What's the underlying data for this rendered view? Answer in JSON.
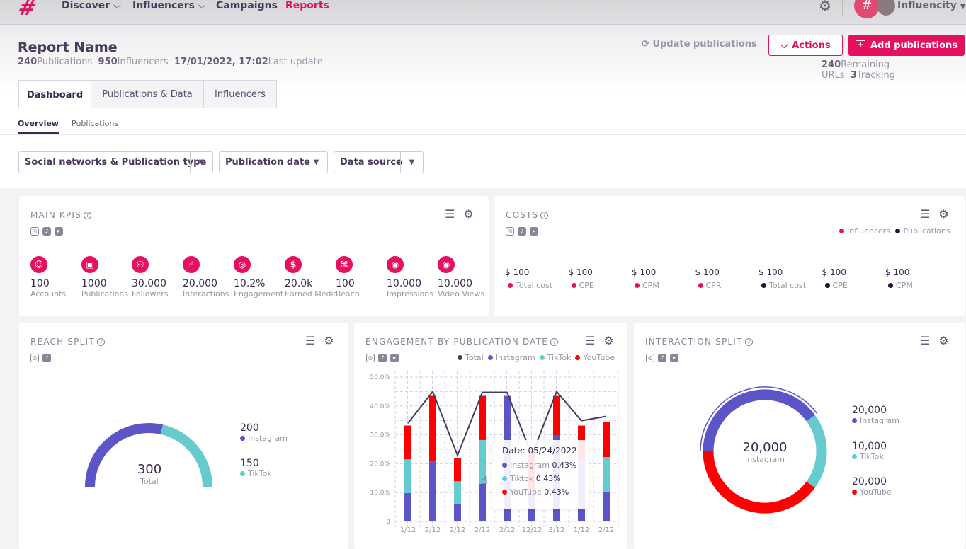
{
  "nav": {
    "logo": "#",
    "items": [
      {
        "label": "Discover",
        "dropdown": true
      },
      {
        "label": "Influencers",
        "dropdown": true
      },
      {
        "label": "Campaigns"
      },
      {
        "label": "Reports",
        "active": true
      }
    ],
    "account": "Influencity"
  },
  "report": {
    "title": "Report Name",
    "publications_count": "240",
    "publications_label": "Publications",
    "influencers_count": "950",
    "influencers_label": "Influencers",
    "last_update": "17/01/2022, 17:02",
    "last_update_label": "Last update"
  },
  "actions": {
    "update": "Update publications",
    "actions": "Actions",
    "add": "Add publications",
    "remaining_count": "240",
    "remaining_label": "Remaining URLs",
    "tracking_count": "3",
    "tracking_label": "Tracking"
  },
  "tabs": [
    {
      "label": "Dashboard",
      "active": true
    },
    {
      "label": "Publications & Data"
    },
    {
      "label": "Influencers"
    }
  ],
  "subtabs": [
    {
      "label": "Overview",
      "active": true
    },
    {
      "label": "Publications"
    }
  ],
  "filters": [
    "Social networks & Publication type",
    "Publication date",
    "Data source"
  ],
  "colors": {
    "brand": "#e5105f",
    "instagram": "#5b55c8",
    "tiktok": "#66cbcf",
    "youtube": "#ff0000",
    "total": "#4a3a5e",
    "publications": "#2a1236"
  },
  "main_kpis": {
    "title": "MAIN KPIS",
    "items": [
      {
        "icon": "user-icon",
        "value": "100",
        "label": "Accounts"
      },
      {
        "icon": "publication-icon",
        "value": "1000",
        "label": "Publications"
      },
      {
        "icon": "followers-icon",
        "value": "30.000",
        "label": "Followers"
      },
      {
        "icon": "hand-pointer-icon",
        "value": "20.000",
        "label": "Interactions"
      },
      {
        "icon": "target-icon",
        "value": "10.2%",
        "label": "Engagement"
      },
      {
        "icon": "dollar-icon",
        "value": "20.0k",
        "label": "Earned Media"
      },
      {
        "icon": "reach-icon",
        "value": "100",
        "label": "Reach"
      },
      {
        "icon": "eye-icon",
        "value": "10.000",
        "label": "Impressions"
      },
      {
        "icon": "eye-icon",
        "value": "10.000",
        "label": "Video Views"
      }
    ]
  },
  "costs": {
    "title": "COSTS",
    "legend": [
      "Influencers",
      "Publications"
    ],
    "items": [
      {
        "value": "$ 100",
        "label": "Total cost",
        "group": "Influencers"
      },
      {
        "value": "$ 100",
        "label": "CPE",
        "group": "Influencers"
      },
      {
        "value": "$ 100",
        "label": "CPM",
        "group": "Influencers"
      },
      {
        "value": "$ 100",
        "label": "CPR",
        "group": "Influencers"
      },
      {
        "value": "$ 100",
        "label": "Total cost",
        "group": "Publications"
      },
      {
        "value": "$ 100",
        "label": "CPE",
        "group": "Publications"
      },
      {
        "value": "$ 100",
        "label": "CPM",
        "group": "Publications"
      }
    ]
  },
  "reach_split": {
    "title": "REACH SPLIT",
    "total": "300",
    "total_label": "Total",
    "items": [
      {
        "value": "200",
        "label": "Instagram",
        "num": 200
      },
      {
        "value": "150",
        "label": "TikTok",
        "num": 150
      }
    ]
  },
  "interaction_split": {
    "title": "INTERACTION SPLIT",
    "center_value": "20,000",
    "center_label": "Instagram",
    "items": [
      {
        "value": "20,000",
        "label": "Instagram",
        "num": 20000
      },
      {
        "value": "10,000",
        "label": "TikTok",
        "num": 10000
      },
      {
        "value": "20,000",
        "label": "YouTube",
        "num": 20000
      }
    ]
  },
  "engagement": {
    "title": "ENGAGEMENT BY PUBLICATION DATE",
    "tooltip": {
      "date": "Date: 05/24/2022",
      "rows": [
        {
          "label": "Instagram",
          "value": "0.43%"
        },
        {
          "label": "Tiktok",
          "value": "0.43%"
        },
        {
          "label": "YouTube",
          "value": "0.43%"
        }
      ]
    }
  },
  "chart_data": {
    "type": "bar",
    "stacked": true,
    "title": "ENGAGEMENT BY PUBLICATION DATE",
    "legend": "top-right",
    "grid": true,
    "categories": [
      "1/12",
      "2/12",
      "2/12",
      "2/12",
      "2/12",
      "12/12",
      "3/12",
      "1/12",
      "2/12"
    ],
    "ylim": [
      0,
      50
    ],
    "yticks": [
      "0",
      "10.0%",
      "20.0%",
      "30.0%",
      "40.0%",
      "50.0%"
    ],
    "series": [
      {
        "name": "Instagram",
        "type": "bar",
        "values": [
          9.8,
          20.8,
          6.1,
          13,
          43.5,
          10,
          29.8,
          21.5,
          10.2
        ]
      },
      {
        "name": "TikTok",
        "type": "bar",
        "values": [
          11.7,
          0,
          7.8,
          15.2,
          0,
          0,
          0,
          0,
          12.1
        ]
      },
      {
        "name": "YouTube",
        "type": "bar",
        "values": [
          11.7,
          22.7,
          7.9,
          15.3,
          0,
          15,
          13.7,
          11.7,
          12.2
        ]
      },
      {
        "name": "Total",
        "type": "line",
        "values": [
          34,
          45,
          22.9,
          44.7,
          44.7,
          23,
          45,
          34.9,
          36.4
        ]
      }
    ]
  }
}
